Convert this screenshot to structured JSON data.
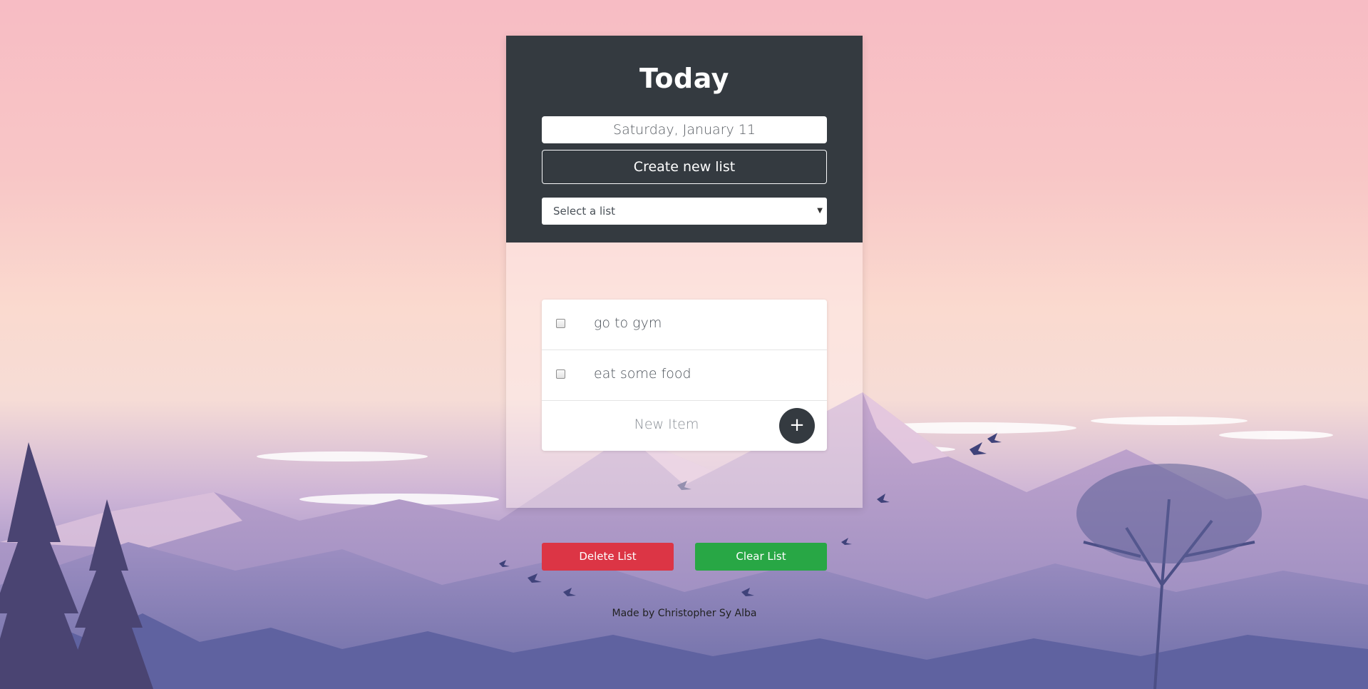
{
  "header": {
    "title": "Today",
    "date": "Saturday, January 11",
    "create_label": "Create new list",
    "select_placeholder": "Select a list"
  },
  "list": {
    "items": [
      {
        "text": "go to gym",
        "checked": false
      },
      {
        "text": "eat some food",
        "checked": false
      }
    ],
    "new_item_placeholder": "New Item",
    "add_symbol": "+"
  },
  "actions": {
    "delete_label": "Delete List",
    "clear_label": "Clear List"
  },
  "footer": {
    "credit": "Made by Christopher Sy Alba"
  },
  "colors": {
    "header_bg": "#343a40",
    "delete": "#dc3545",
    "clear": "#28a745"
  },
  "icons": {
    "add": "plus-icon",
    "dropdown": "caret-down-icon"
  }
}
